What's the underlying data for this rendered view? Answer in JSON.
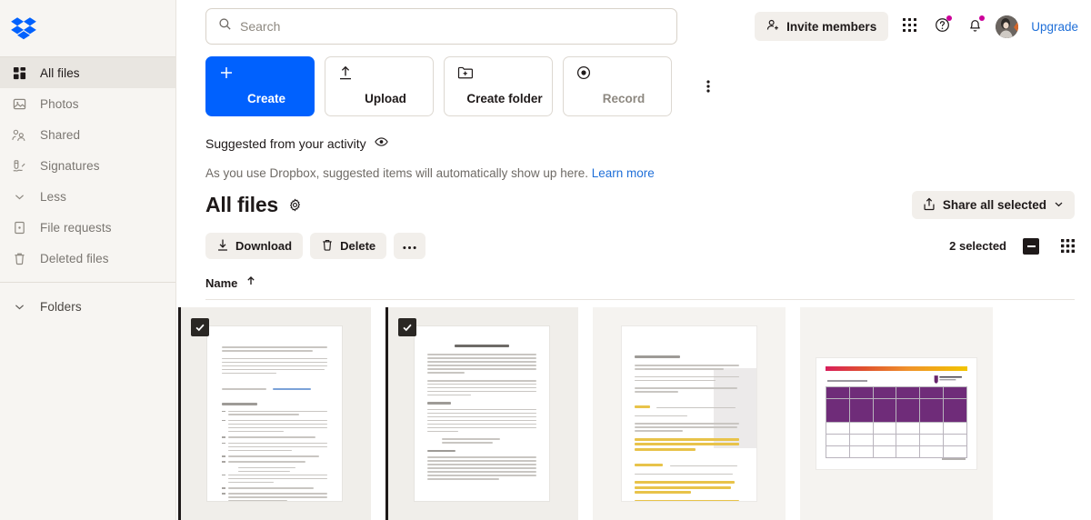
{
  "brand": {
    "name": "Dropbox",
    "logo_icon": "dropbox-logo",
    "accent": "#0061fe",
    "badge": "#cc0099"
  },
  "sidebar": {
    "items": [
      {
        "label": "All files",
        "icon": "all-files-icon",
        "active": true
      },
      {
        "label": "Photos",
        "icon": "photos-icon",
        "active": false
      },
      {
        "label": "Shared",
        "icon": "shared-people-icon",
        "active": false
      },
      {
        "label": "Signatures",
        "icon": "signature-pen-icon",
        "active": false
      },
      {
        "label": "Less",
        "icon": "chevron-down-icon",
        "active": false
      },
      {
        "label": "File requests",
        "icon": "file-request-icon",
        "active": false
      },
      {
        "label": "Deleted files",
        "icon": "trash-icon",
        "active": false
      }
    ],
    "folders": {
      "label": "Folders",
      "icon": "chevron-down-icon"
    }
  },
  "topbar": {
    "search": {
      "placeholder": "Search",
      "value": "",
      "icon": "search-icon"
    },
    "invite_label": "Invite members",
    "invite_icon": "add-person-icon",
    "apps_icon": "app-grid-icon",
    "help_icon": "help-circle-icon",
    "notifications_icon": "bell-icon",
    "avatar_icon": "user-avatar",
    "upgrade_label": "Upgrade"
  },
  "action_tiles": [
    {
      "label": "Create",
      "icon": "plus-icon",
      "primary": true,
      "muted": false
    },
    {
      "label": "Upload",
      "icon": "upload-arrow-icon",
      "primary": false,
      "muted": false
    },
    {
      "label": "Create folder",
      "icon": "folder-plus-icon",
      "primary": false,
      "muted": false
    },
    {
      "label": "Record",
      "icon": "record-circle-icon",
      "primary": false,
      "muted": true
    }
  ],
  "tiles_overflow_icon": "more-vertical-icon",
  "suggested": {
    "heading": "Suggested from your activity",
    "heading_icon": "eye-icon",
    "body": "As you use Dropbox, suggested items will automatically show up here.",
    "link": "Learn more"
  },
  "files_section": {
    "title": "All files",
    "settings_icon": "gear-icon",
    "share_all_label": "Share all selected",
    "share_all_icon": "share-up-icon",
    "share_all_chevron": "chevron-down-icon"
  },
  "selection_toolbar": {
    "download_label": "Download",
    "download_icon": "download-icon",
    "delete_label": "Delete",
    "delete_icon": "trash-icon",
    "more_icon": "more-horizontal-icon",
    "selected_count_label": "2 selected",
    "select_all_checkbox_state": "indeterminate",
    "view_toggle_icon": "grid-view-icon"
  },
  "columns": {
    "name_label": "Name",
    "sort_icon": "arrow-up-icon",
    "sort_direction": "ascending"
  },
  "file_cards": [
    {
      "kind": "document-portrait",
      "selected": true,
      "checkbox_icon": "check-icon",
      "preview_title": ""
    },
    {
      "kind": "document-portrait",
      "selected": true,
      "checkbox_icon": "check-icon",
      "preview_title": "Common Bad Habits"
    },
    {
      "kind": "document-portrait-highlighted",
      "selected": false,
      "checkbox_icon": "",
      "preview_title": "Communication styles"
    },
    {
      "kind": "document-landscape-table",
      "selected": false,
      "checkbox_icon": "",
      "preview_title": "Communication plan"
    }
  ]
}
